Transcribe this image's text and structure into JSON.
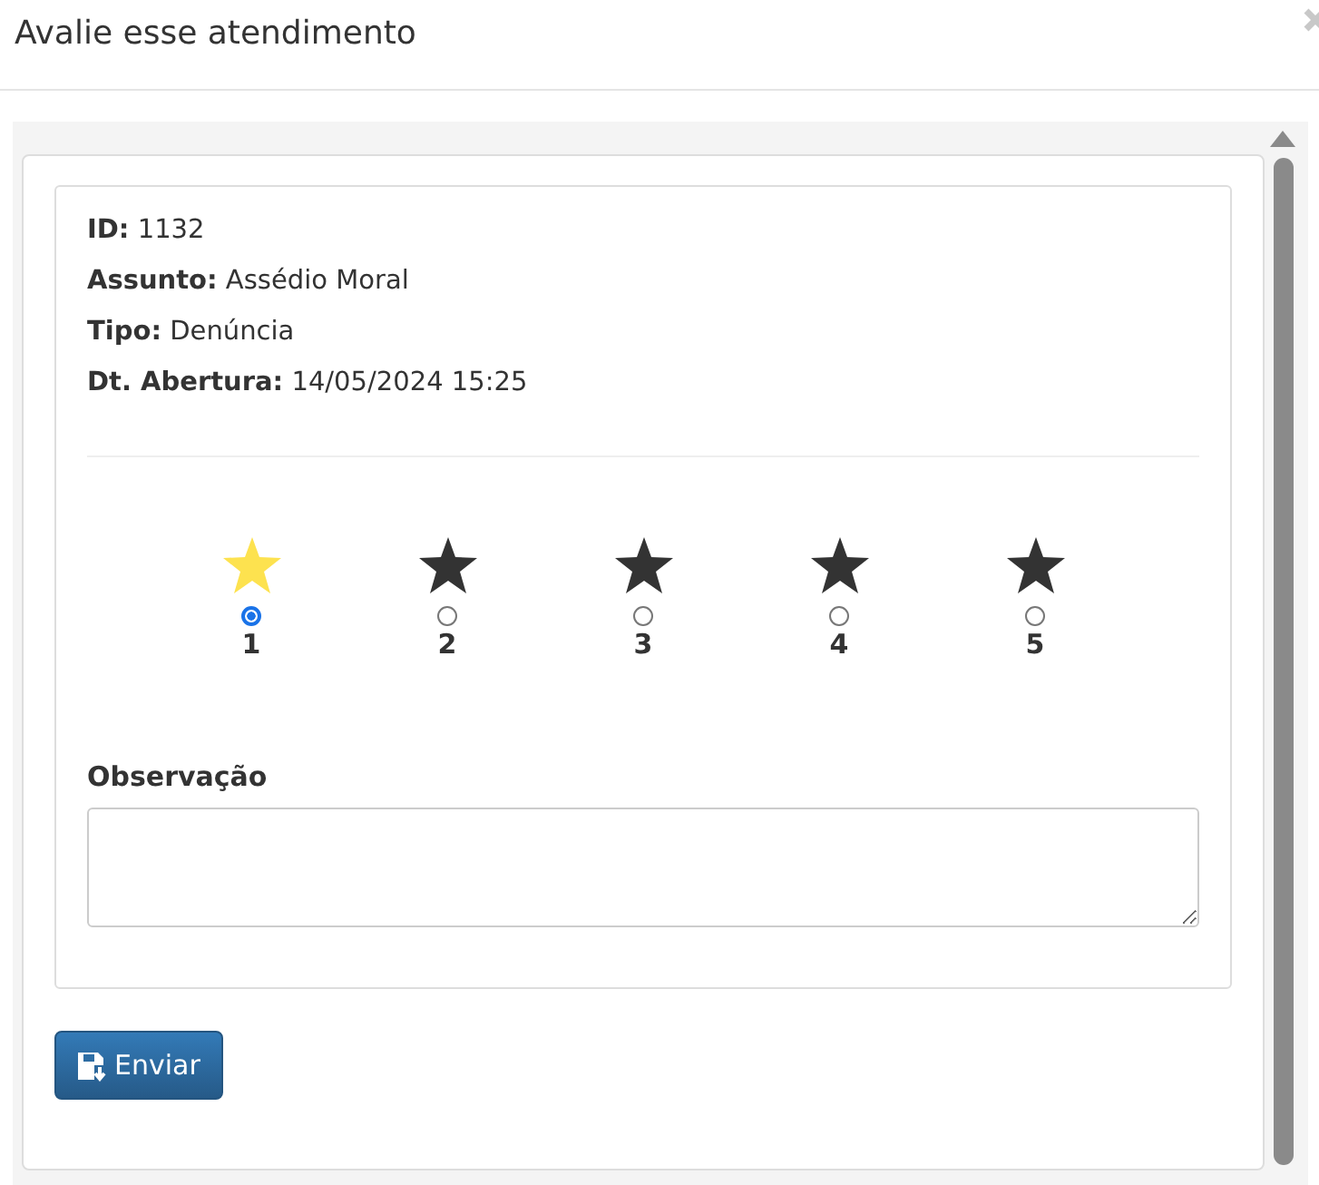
{
  "dialog": {
    "title": "Avalie esse atendimento"
  },
  "details": [
    "**ID:** 1132",
    "**Assunto:** Assédio Moral",
    "**Tipo:** Denúncia",
    "**Dt. Abertura:** 14/05/2024 15:25"
  ],
  "rating": [
    {
      "label": "1",
      "selected": true
    },
    {
      "label": "2",
      "selected": false
    },
    {
      "label": "3",
      "selected": false
    },
    {
      "label": "4",
      "selected": false
    },
    {
      "label": "5",
      "selected": false
    }
  ],
  "observation": {
    "label": "Observação"
  },
  "submit": {
    "label": "Enviar"
  }
}
